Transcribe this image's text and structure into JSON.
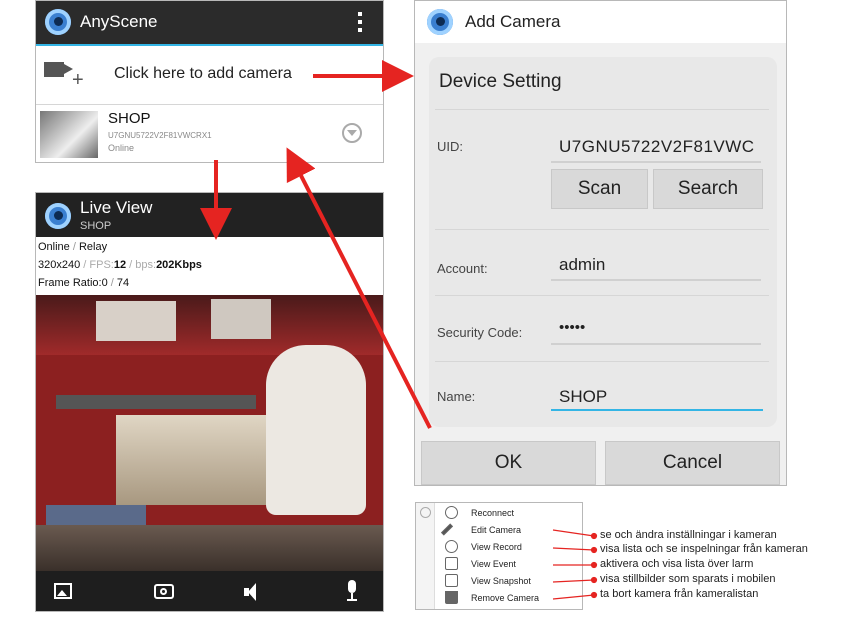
{
  "camera_list": {
    "app_title": "AnyScene",
    "add_camera_text": "Click here to add camera",
    "camera": {
      "name": "SHOP",
      "uid": "U7GNU5722V2F81VWCRX1",
      "status": "Online"
    }
  },
  "live_view": {
    "title": "Live View",
    "subtitle": "SHOP",
    "status_online": "Online",
    "status_sep": " / ",
    "status_mode": "Relay",
    "resolution": "320x240",
    "sep1": " / ",
    "fps_label": "FPS:",
    "fps_value": "12",
    "sep2": " / ",
    "bps_label": "bps:",
    "bps_value": "202Kbps",
    "frame_ratio_label": "Frame Ratio:",
    "frame_ratio_a": "0",
    "frame_ratio_sep": " / ",
    "frame_ratio_b": "74"
  },
  "add_camera": {
    "title": "Add Camera",
    "section": "Device Setting",
    "uid_label": "UID:",
    "uid_value": "U7GNU5722V2F81VWC",
    "scan_label": "Scan",
    "search_label": "Search",
    "account_label": "Account:",
    "account_value": "admin",
    "security_label": "Security Code:",
    "security_value": "•••••",
    "name_label": "Name:",
    "name_value": "SHOP",
    "ok_label": "OK",
    "cancel_label": "Cancel"
  },
  "context_menu": {
    "items": [
      "Reconnect",
      "Edit Camera",
      "View Record",
      "View Event",
      "View Snapshot",
      "Remove Camera"
    ]
  },
  "annotations": [
    "se och ändra inställningar i kameran",
    "visa lista och se inspelningar från kameran",
    "aktivera och visa lista över larm",
    "visa stillbilder som sparats i mobilen",
    "ta bort kamera från kameralistan"
  ],
  "colors": {
    "appbar": "#2b2b2b",
    "accent_blue": "#33b5e5",
    "arrow_red": "#e52421"
  }
}
